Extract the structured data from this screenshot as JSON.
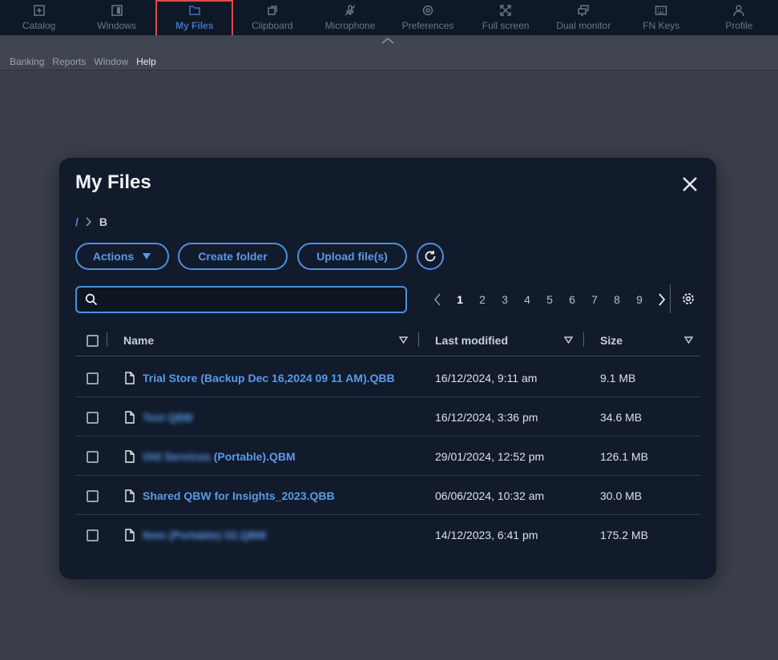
{
  "toolbar": {
    "items": [
      {
        "label": "Catalog",
        "icon": "plus-box-icon"
      },
      {
        "label": "Windows",
        "icon": "window-icon"
      },
      {
        "label": "My Files",
        "icon": "folder-icon"
      },
      {
        "label": "Clipboard",
        "icon": "clipboard-icon"
      },
      {
        "label": "Microphone",
        "icon": "microphone-off-icon"
      },
      {
        "label": "Preferences",
        "icon": "gear-icon"
      },
      {
        "label": "Full screen",
        "icon": "fullscreen-icon"
      },
      {
        "label": "Dual monitor",
        "icon": "dual-monitor-icon"
      },
      {
        "label": "FN Keys",
        "icon": "keyboard-icon"
      },
      {
        "label": "Profile",
        "icon": "user-icon"
      }
    ],
    "active": "My Files",
    "accent": "#3e74c6",
    "highlight": "#e14b4b"
  },
  "menubar": {
    "items": [
      "Banking",
      "Reports",
      "Window",
      "Help"
    ]
  },
  "dialog": {
    "title": "My Files",
    "breadcrumb": {
      "root": "/",
      "current": "B"
    },
    "buttons": {
      "actions": "Actions",
      "create_folder": "Create folder",
      "upload": "Upload file(s)"
    },
    "search": {
      "value": "",
      "placeholder": ""
    },
    "pagination": {
      "current": "1",
      "pages": [
        "1",
        "2",
        "3",
        "4",
        "5",
        "6",
        "7",
        "8",
        "9"
      ]
    },
    "columns": {
      "name": "Name",
      "modified": "Last modified",
      "size": "Size"
    },
    "files": [
      {
        "name_blurred": "",
        "name": "Trial Store (Backup Dec 16,2024 09 11 AM).QBB",
        "modified": "16/12/2024, 9:11 am",
        "size": "9.1 MB"
      },
      {
        "name_blurred": "Test QBB",
        "name": "",
        "modified": "16/12/2024, 3:36 pm",
        "size": "34.6 MB"
      },
      {
        "name_blurred": "Old Services",
        "name": " (Portable).QBM",
        "modified": "29/01/2024, 12:52 pm",
        "size": "126.1 MB"
      },
      {
        "name_blurred": "",
        "name": "Shared QBW for Insights_2023.QBB",
        "modified": "06/06/2024, 10:32 am",
        "size": "30.0 MB"
      },
      {
        "name_blurred": "Item (Portable) 02.QBM",
        "name": "",
        "modified": "14/12/2023, 6:41 pm",
        "size": "175.2 MB"
      }
    ],
    "link_color": "#5a9ae8"
  }
}
